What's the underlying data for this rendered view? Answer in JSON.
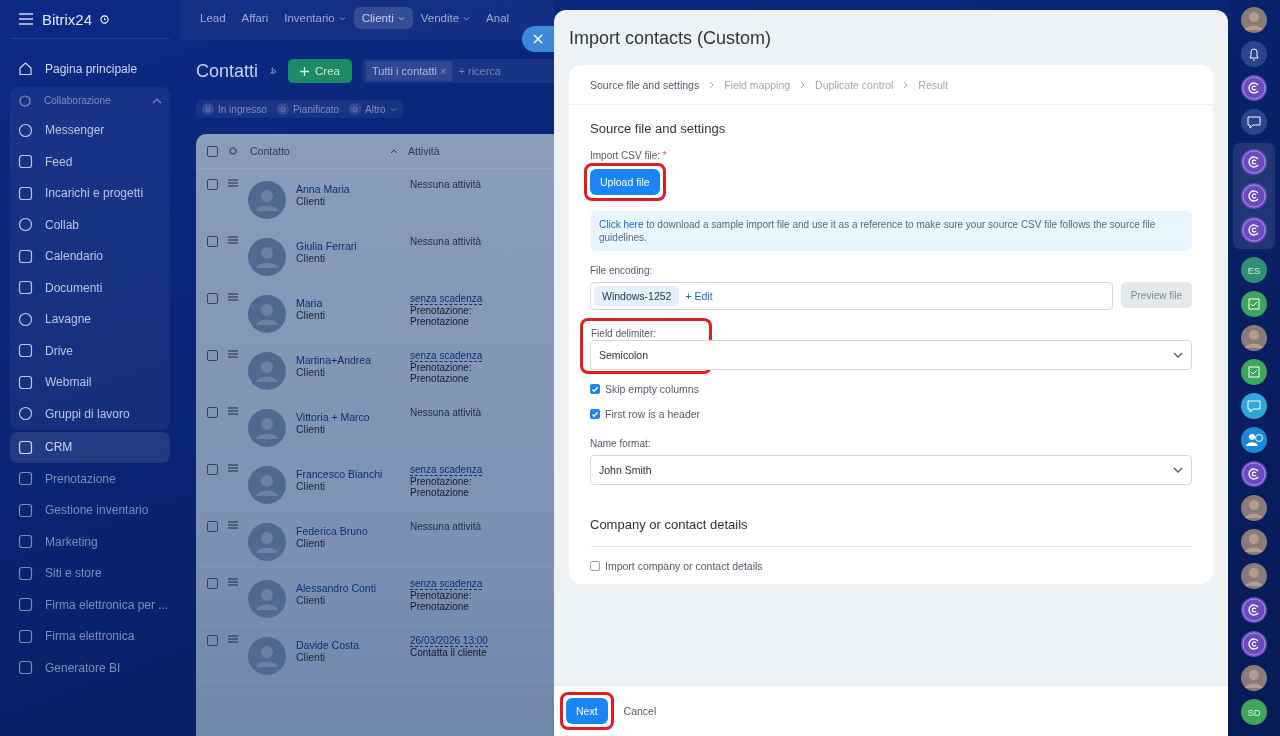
{
  "sidebar": {
    "logo": "Bitrix24",
    "items": [
      {
        "label": "Pagina principale",
        "selected": false
      },
      {
        "label": "Collaborazione",
        "expanded": true,
        "children": [
          {
            "label": "Messenger",
            "selected": false
          },
          {
            "label": "Feed",
            "selected": false
          },
          {
            "label": "Incarichi e progetti",
            "selected": false
          },
          {
            "label": "Collab",
            "selected": false
          },
          {
            "label": "Calendario",
            "selected": false
          },
          {
            "label": "Documenti",
            "selected": false
          },
          {
            "label": "Lavagne",
            "selected": false
          },
          {
            "label": "Drive",
            "selected": false
          },
          {
            "label": "Webmail",
            "selected": false
          },
          {
            "label": "Gruppi di lavoro",
            "selected": false
          }
        ]
      },
      {
        "label": "CRM",
        "selected": true
      },
      {
        "label": "Prenotazione",
        "selected": false
      },
      {
        "label": "Gestione inventario",
        "selected": false
      },
      {
        "label": "Marketing",
        "selected": false
      },
      {
        "label": "Siti e store",
        "selected": false
      },
      {
        "label": "Firma elettronica per ...",
        "selected": false
      },
      {
        "label": "Firma elettronica",
        "selected": false
      },
      {
        "label": "Generatore BI",
        "selected": false
      }
    ]
  },
  "topnav": [
    {
      "label": "Lead",
      "selected": false,
      "dropdown": false
    },
    {
      "label": "Affari",
      "selected": false,
      "dropdown": false
    },
    {
      "label": "Inventario",
      "selected": false,
      "dropdown": true
    },
    {
      "label": "Clienti",
      "selected": true,
      "dropdown": true
    },
    {
      "label": "Vendite",
      "selected": false,
      "dropdown": true
    },
    {
      "label": "Anal",
      "selected": false,
      "dropdown": false
    }
  ],
  "page": {
    "title": "Contatti",
    "create_button": "Crea",
    "filter_chip": "Tutti i contatti",
    "chip_close": "×",
    "search_placeholder": "+ ricerca",
    "counters": [
      {
        "count": "0",
        "label": "In ingresso",
        "dropdown": false
      },
      {
        "count": "0",
        "label": "Pianificato",
        "dropdown": false
      },
      {
        "count": "0",
        "label": "Altro",
        "dropdown": true
      }
    ]
  },
  "table": {
    "columns": [
      "Contatto",
      "Attività"
    ],
    "select_all_checked": false,
    "rows": [
      {
        "name": "Anna Maria",
        "type": "Clienti",
        "checked": false,
        "activity": {
          "kind": "none",
          "text": "Nessuna attività"
        }
      },
      {
        "name": "Giulia Ferrari",
        "type": "Clienti",
        "checked": false,
        "activity": {
          "kind": "none",
          "text": "Nessuna attività"
        }
      },
      {
        "name": "Maria",
        "type": "Clienti",
        "checked": false,
        "activity": {
          "kind": "deadline",
          "link": "senza scadenza",
          "lines": [
            "Prenotazione:",
            "Prenotazione"
          ]
        }
      },
      {
        "name": "Martina+Andrea",
        "type": "Clienti",
        "checked": false,
        "activity": {
          "kind": "deadline",
          "link": "senza scadenza",
          "lines": [
            "Prenotazione:",
            "Prenotazione"
          ]
        }
      },
      {
        "name": "Vittoria + Marco",
        "type": "Clienti",
        "checked": false,
        "activity": {
          "kind": "none",
          "text": "Nessuna attività"
        }
      },
      {
        "name": "Francesco Bianchi",
        "type": "Clienti",
        "checked": false,
        "activity": {
          "kind": "deadline",
          "link": "senza scadenza",
          "lines": [
            "Prenotazione:",
            "Prenotazione"
          ]
        }
      },
      {
        "name": "Federica Bruno",
        "type": "Clienti",
        "checked": false,
        "activity": {
          "kind": "none",
          "text": "Nessuna attività"
        }
      },
      {
        "name": "Alessandro Conti",
        "type": "Clienti",
        "checked": false,
        "activity": {
          "kind": "deadline",
          "link": "senza scadenza",
          "lines": [
            "Prenotazione:",
            "Prenotazione"
          ]
        }
      },
      {
        "name": "Davide Costa",
        "type": "Clienti",
        "checked": false,
        "activity": {
          "kind": "deadline",
          "link": "26/03/2026 13:00",
          "lines": [
            "Contatta il cliente"
          ]
        }
      }
    ]
  },
  "panel": {
    "title": "Import contacts (Custom)",
    "steps": [
      {
        "label": "Source file and settings",
        "selected": true
      },
      {
        "label": "Field mapping",
        "selected": false
      },
      {
        "label": "Duplicate control",
        "selected": false
      },
      {
        "label": "Result",
        "selected": false
      }
    ],
    "section_title": "Source file and settings",
    "upload": {
      "label": "Import CSV file:",
      "required": "*",
      "button": "Upload file",
      "highlighted": true
    },
    "info": {
      "link": "Click here",
      "text": " to download a sample import file and use it as a reference to make sure your source CSV file follows the source file guidelines."
    },
    "encoding": {
      "label": "File encoding:",
      "value": "Windows-1252",
      "edit": "+ Edit",
      "preview_button": "Preview file",
      "preview_disabled": true
    },
    "delimiter": {
      "label": "Field delimiter:",
      "value": "Semicolon",
      "highlighted": true
    },
    "checkboxes": [
      {
        "label": "Skip empty columns",
        "checked": true
      },
      {
        "label": "First row is a header",
        "checked": true
      }
    ],
    "name_format": {
      "label": "Name format:",
      "value": "John Smith"
    },
    "section2_title": "Company or contact details",
    "details_checkbox": {
      "label": "Import company or contact details",
      "checked": false
    },
    "footer": {
      "next": "Next",
      "next_highlighted": true,
      "cancel": "Cancel"
    }
  },
  "rightbar": {
    "items": [
      {
        "kind": "avatar"
      },
      {
        "kind": "bell"
      },
      {
        "kind": "swirl"
      },
      {
        "kind": "chat"
      }
    ],
    "pinned": [
      {
        "kind": "swirl"
      },
      {
        "kind": "swirl"
      },
      {
        "kind": "swirl"
      }
    ],
    "more": [
      {
        "kind": "initials",
        "text": "ES",
        "color": "#2f8f76"
      },
      {
        "kind": "check",
        "color": "#3fa55a"
      },
      {
        "kind": "avatar"
      },
      {
        "kind": "check",
        "color": "#3fa55a"
      },
      {
        "kind": "chat",
        "color": "#2fa8d8"
      },
      {
        "kind": "user-clock",
        "color": "#1e88d8"
      },
      {
        "kind": "swirl"
      },
      {
        "kind": "avatar"
      },
      {
        "kind": "avatar"
      },
      {
        "kind": "avatar"
      },
      {
        "kind": "swirl"
      },
      {
        "kind": "swirl"
      },
      {
        "kind": "avatar"
      },
      {
        "kind": "initials",
        "text": "SD",
        "color": "#3fa55a"
      }
    ]
  }
}
